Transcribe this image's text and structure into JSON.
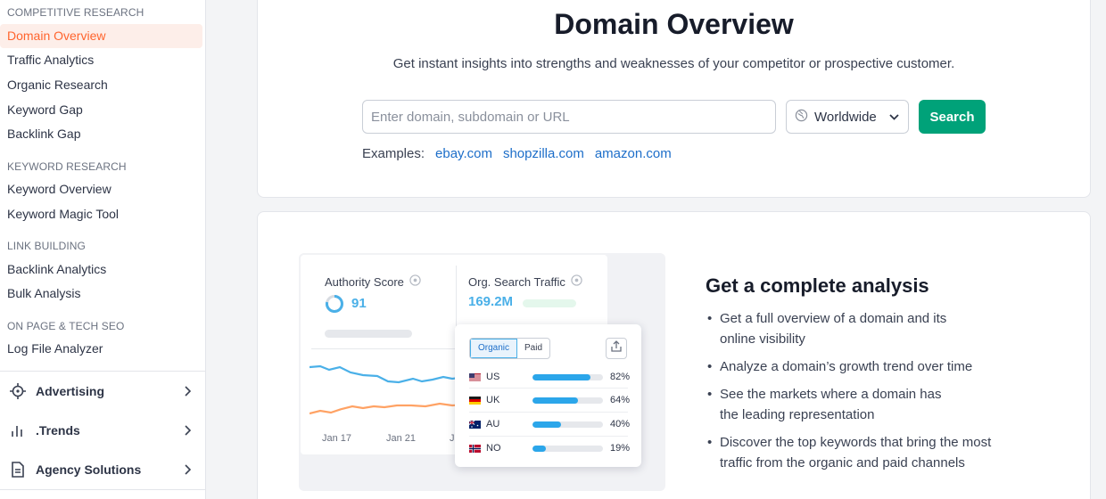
{
  "sidebar": {
    "sections": [
      {
        "title": "COMPETITIVE RESEARCH"
      },
      {
        "title": "KEYWORD RESEARCH"
      },
      {
        "title": "LINK BUILDING"
      },
      {
        "title": "ON PAGE & TECH SEO"
      }
    ],
    "items": [
      {
        "label": "Domain Overview",
        "active": true
      },
      {
        "label": "Traffic Analytics"
      },
      {
        "label": "Organic Research"
      },
      {
        "label": "Keyword Gap"
      },
      {
        "label": "Backlink Gap"
      },
      {
        "label": "Keyword Overview"
      },
      {
        "label": "Keyword Magic Tool"
      },
      {
        "label": "Backlink Analytics"
      },
      {
        "label": "Bulk Analysis"
      },
      {
        "label": "Log File Analyzer"
      }
    ],
    "groups": [
      {
        "label": "Advertising",
        "icon": "crosshair-icon"
      },
      {
        "label": ".Trends",
        "icon": "bar-chart-icon"
      },
      {
        "label": "Agency Solutions",
        "icon": "document-icon"
      }
    ],
    "active_color": "#ff642d"
  },
  "header": {
    "title": "Domain Overview",
    "subtitle": "Get instant insights into strengths and weaknesses of your competitor or prospective customer."
  },
  "search": {
    "placeholder": "Enter domain, subdomain or URL",
    "value": "",
    "region": "Worldwide",
    "button_label": "Search",
    "button_color": "#00a279"
  },
  "examples": {
    "label": "Examples:",
    "links": [
      "ebay.com",
      "shopzilla.com",
      "amazon.com"
    ]
  },
  "illustration": {
    "authority": {
      "label": "Authority Score",
      "value": "91"
    },
    "traffic": {
      "label": "Org. Search Traffic",
      "value": "169.2M"
    },
    "axis_labels": [
      "Jan 17",
      "Jan 21",
      "J"
    ],
    "tabs": [
      "Organic",
      "Paid"
    ],
    "countries": [
      {
        "code": "US",
        "percent": "82%",
        "share": 0.82
      },
      {
        "code": "UK",
        "percent": "64%",
        "share": 0.64
      },
      {
        "code": "AU",
        "percent": "40%",
        "share": 0.4
      },
      {
        "code": "NO",
        "percent": "19%",
        "share": 0.19
      }
    ]
  },
  "features": {
    "title": "Get a complete analysis",
    "items": [
      "Get a full overview of a domain and its\nonline visibility",
      "Analyze a domain’s growth trend over time",
      "See the markets where a domain has\nthe leading representation",
      "Discover the top keywords that bring the most\ntraffic from the organic and paid channels"
    ]
  }
}
